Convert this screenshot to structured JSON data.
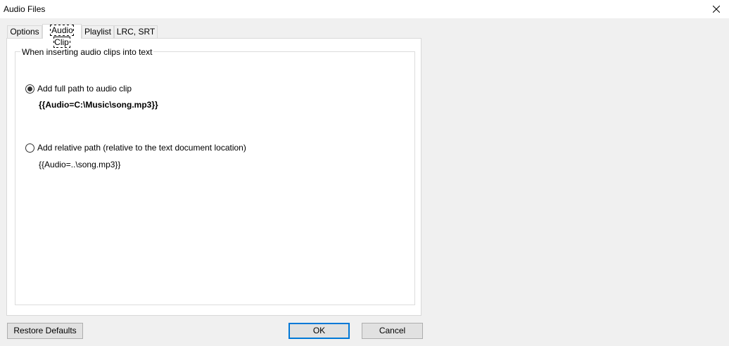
{
  "window": {
    "title": "Audio Files"
  },
  "tabs": [
    {
      "label": "Options",
      "active": false
    },
    {
      "label": "Audio Clip",
      "active": true
    },
    {
      "label": "Playlist",
      "active": false
    },
    {
      "label": "LRC, SRT",
      "active": false
    }
  ],
  "group": {
    "title": "When inserting audio clips into text",
    "options": [
      {
        "label": "Add full path to audio clip",
        "checked": true,
        "example": "{{Audio=C:\\Music\\song.mp3}}"
      },
      {
        "label": "Add relative path (relative to the text document location)",
        "checked": false,
        "example": "{{Audio=..\\song.mp3}}"
      }
    ]
  },
  "buttons": {
    "restore_defaults": "Restore Defaults",
    "ok": "OK",
    "cancel": "Cancel"
  },
  "icons": {
    "close": "close-icon"
  },
  "colors": {
    "accent": "#0078d7",
    "panel_bg": "#ffffff",
    "window_bg": "#f0f0f0"
  }
}
